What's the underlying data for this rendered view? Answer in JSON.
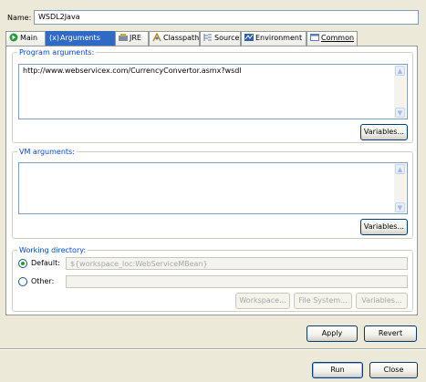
{
  "name_field": {
    "label": "Name:",
    "value": "WSDL2Java"
  },
  "tabs": [
    {
      "label": "Main",
      "icon": "main-icon"
    },
    {
      "label": "Arguments",
      "icon": "arguments-icon"
    },
    {
      "label": "JRE",
      "icon": "jre-icon"
    },
    {
      "label": "Classpath",
      "icon": "classpath-icon"
    },
    {
      "label": "Source",
      "icon": "source-icon"
    },
    {
      "label": "Environment",
      "icon": "environment-icon"
    },
    {
      "label": "Common",
      "icon": "common-icon"
    }
  ],
  "program_arguments": {
    "label": "Program arguments:",
    "value": "http://www.webservicex.com/CurrencyConvertor.asmx?wsdl",
    "variables_button": "Variables..."
  },
  "vm_arguments": {
    "label": "VM arguments:",
    "value": "",
    "variables_button": "Variables..."
  },
  "working_directory": {
    "label": "Working directory:",
    "default_label": "Default:",
    "default_value": "${workspace_loc:WebServiceMBean}",
    "default_selected": true,
    "other_label": "Other:",
    "other_value": "",
    "workspace_button": "Workspace...",
    "file_system_button": "File System...",
    "variables_button": "Variables..."
  },
  "actions": {
    "apply": "Apply",
    "revert": "Revert"
  },
  "footer": {
    "run": "Run",
    "close": "Close"
  },
  "colors": {
    "accent": "#316ac5",
    "group_label": "#0046d5",
    "background": "#ece9d8"
  }
}
